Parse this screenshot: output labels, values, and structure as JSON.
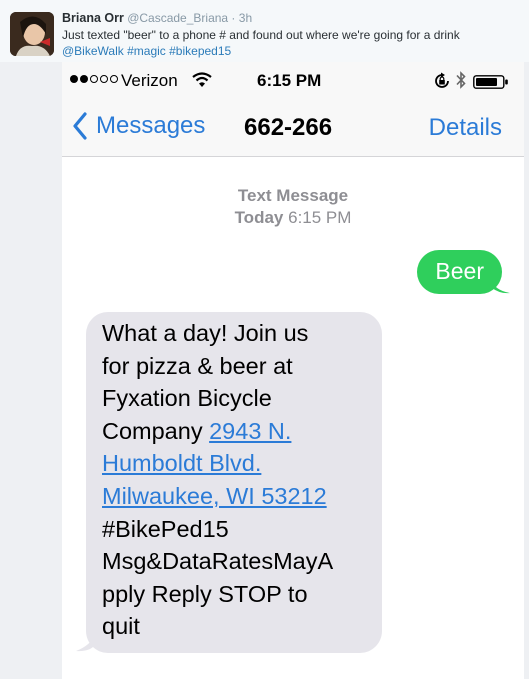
{
  "tweet": {
    "author_name": "Briana Orr",
    "author_handle": "@Cascade_Briana",
    "separator": " · ",
    "time_ago": "3h",
    "text": "Just texted \"beer\" to a phone # and found out where we're going for a drink",
    "hashtags": [
      "@BikeWalk",
      "#magic",
      "#bikeped15"
    ]
  },
  "status_bar": {
    "signal_dots_filled": 2,
    "signal_dots_total": 5,
    "carrier": "Verizon",
    "time": "6:15 PM",
    "icons": [
      "wifi-icon",
      "rotation-lock-icon",
      "bluetooth-icon",
      "battery-icon"
    ]
  },
  "nav": {
    "back_label": "Messages",
    "contact": "662-266",
    "details_label": "Details"
  },
  "thread": {
    "type_label": "Text Message",
    "date_label": "Today",
    "time_label": "6:15 PM"
  },
  "messages": {
    "sent": "Beer",
    "received_lines": [
      "What a day! Join us",
      "for pizza & beer at",
      "Fyxation Bicycle",
      "Company "
    ],
    "address_lines": [
      "2943 N.",
      "Humboldt Blvd.",
      "Milwaukee, WI 53212"
    ],
    "received_tail_lines": [
      "#BikePed15",
      "Msg&DataRatesMayA",
      "pply Reply STOP to",
      "quit"
    ]
  },
  "colors": {
    "ios_blue": "#2b7bd7",
    "sent_bubble": "#2fcf5c",
    "received_bubble": "#e6e5eb",
    "twitter_link": "#2b7bb9"
  }
}
